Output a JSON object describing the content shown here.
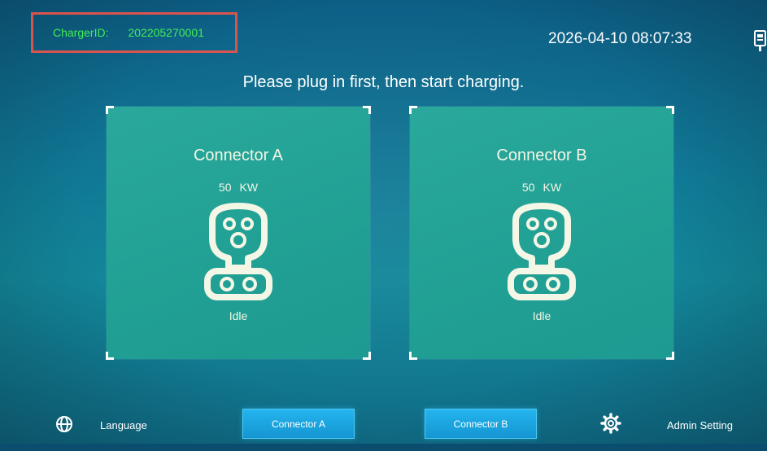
{
  "header": {
    "charger_id_label": "ChargerID:",
    "charger_id_value": "202205270001",
    "datetime": "2026-04-10 08:07:33"
  },
  "main": {
    "message": "Please plug in first, then start charging.",
    "connectors": [
      {
        "title": "Connector A",
        "power_value": "50",
        "power_unit": "KW",
        "status": "Idle"
      },
      {
        "title": "Connector B",
        "power_value": "50",
        "power_unit": "KW",
        "status": "Idle"
      }
    ]
  },
  "footer": {
    "language_label": "Language",
    "connector_a_button": "Connector A",
    "connector_b_button": "Connector B",
    "admin_label": "Admin Setting"
  },
  "icons": {
    "language": "globe-icon",
    "admin": "gear-icon",
    "connector": "ev-plug-icon",
    "top_right": "device-icon"
  },
  "colors": {
    "background": "#107895",
    "card": "#22a195",
    "charger_id_text": "#44ee55",
    "highlight_border": "#d9534f",
    "button": "#1a9fdc"
  }
}
